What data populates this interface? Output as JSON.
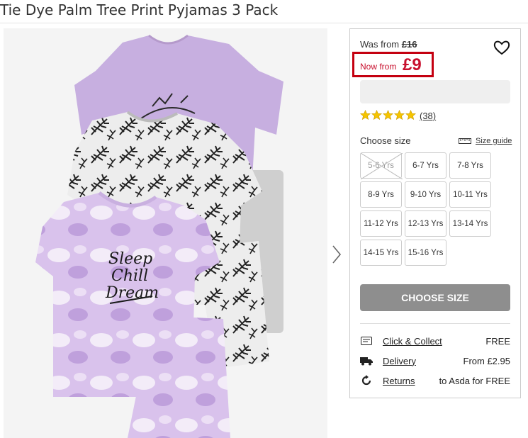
{
  "product": {
    "title": "Tie Dye Palm Tree Print Pyjamas 3 Pack"
  },
  "image": {
    "alt": "Tie Dye Palm Tree Print Pyjamas 3 Pack",
    "tee_slogan_line1": "Sleep",
    "tee_slogan_line2": "Chill",
    "tee_slogan_line3": "Dream"
  },
  "price": {
    "was_label": "Was from",
    "was_value": "£16",
    "now_label": "Now from",
    "now_value": "£9"
  },
  "rating": {
    "stars": 5,
    "review_count": "(38)"
  },
  "sizes": {
    "label": "Choose size",
    "guide_label": "Size guide",
    "options": [
      {
        "label": "5-6 Yrs",
        "available": false
      },
      {
        "label": "6-7 Yrs",
        "available": true
      },
      {
        "label": "7-8 Yrs",
        "available": true
      },
      {
        "label": "8-9 Yrs",
        "available": true
      },
      {
        "label": "9-10 Yrs",
        "available": true
      },
      {
        "label": "10-11 Yrs",
        "available": true
      },
      {
        "label": "11-12 Yrs",
        "available": true
      },
      {
        "label": "12-13 Yrs",
        "available": true
      },
      {
        "label": "13-14 Yrs",
        "available": true
      },
      {
        "label": "14-15 Yrs",
        "available": true
      },
      {
        "label": "15-16 Yrs",
        "available": true
      }
    ]
  },
  "cta": {
    "label": "CHOOSE SIZE"
  },
  "services": [
    {
      "icon": "click-collect-icon",
      "label": "Click & Collect",
      "value": "FREE"
    },
    {
      "icon": "delivery-truck-icon",
      "label": "Delivery",
      "value": "From £2.95"
    },
    {
      "icon": "returns-icon",
      "label": "Returns",
      "value": "to Asda for FREE"
    }
  ],
  "colors": {
    "price_red": "#c8102e",
    "button_grey": "#8e8e8e",
    "star_yellow": "#f5c400",
    "lilac": "#c9a9e3"
  }
}
